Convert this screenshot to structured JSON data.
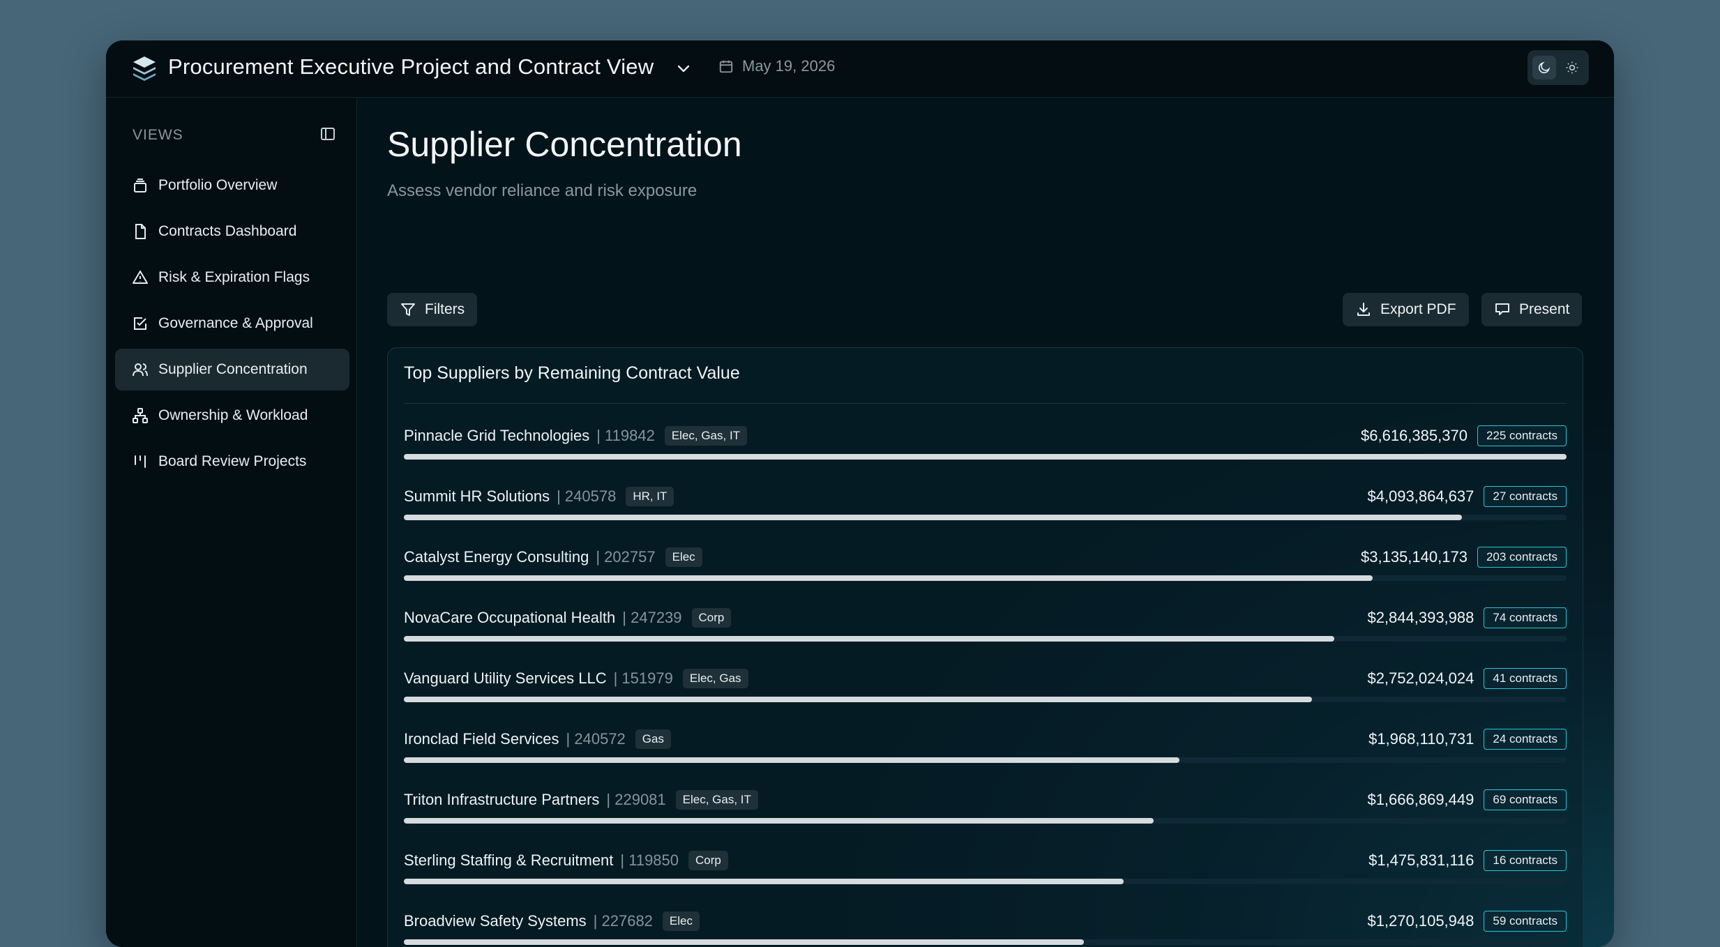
{
  "header": {
    "title": "Procurement Executive Project and Contract View",
    "date": "May 19, 2026"
  },
  "sidebar": {
    "section_label": "VIEWS",
    "items": [
      {
        "label": "Portfolio Overview",
        "icon": "layers-icon"
      },
      {
        "label": "Contracts Dashboard",
        "icon": "file-icon"
      },
      {
        "label": "Risk & Expiration Flags",
        "icon": "warning-icon"
      },
      {
        "label": "Governance & Approval",
        "icon": "checkbox-icon"
      },
      {
        "label": "Supplier Concentration",
        "icon": "users-icon",
        "active": true
      },
      {
        "label": "Ownership & Workload",
        "icon": "org-chart-icon"
      },
      {
        "label": "Board Review Projects",
        "icon": "kanban-icon"
      }
    ]
  },
  "main": {
    "title": "Supplier Concentration",
    "subtitle": "Assess vendor reliance and risk exposure",
    "filters_label": "Filters",
    "export_label": "Export PDF",
    "present_label": "Present"
  },
  "card": {
    "title": "Top Suppliers by Remaining Contract Value",
    "suppliers": [
      {
        "name": "Pinnacle Grid Technologies",
        "id": "| 119842",
        "tags": "Elec, Gas, IT",
        "amount": "$6,616,385,370",
        "contracts": "225 contracts",
        "share": 1.0
      },
      {
        "name": "Summit HR Solutions",
        "id": "| 240578",
        "tags": "HR, IT",
        "amount": "$4,093,864,637",
        "contracts": "27 contracts",
        "share": 0.91
      },
      {
        "name": "Catalyst Energy Consulting",
        "id": "| 202757",
        "tags": "Elec",
        "amount": "$3,135,140,173",
        "contracts": "203 contracts",
        "share": 0.833
      },
      {
        "name": "NovaCare Occupational Health",
        "id": "| 247239",
        "tags": "Corp",
        "amount": "$2,844,393,988",
        "contracts": "74 contracts",
        "share": 0.8
      },
      {
        "name": "Vanguard Utility Services LLC",
        "id": "| 151979",
        "tags": "Elec, Gas",
        "amount": "$2,752,024,024",
        "contracts": "41 contracts",
        "share": 0.781
      },
      {
        "name": "Ironclad Field Services",
        "id": "| 240572",
        "tags": "Gas",
        "amount": "$1,968,110,731",
        "contracts": "24 contracts",
        "share": 0.667
      },
      {
        "name": "Triton Infrastructure Partners",
        "id": "| 229081",
        "tags": "Elec, Gas, IT",
        "amount": "$1,666,869,449",
        "contracts": "69 contracts",
        "share": 0.645
      },
      {
        "name": "Sterling Staffing & Recruitment",
        "id": "| 119850",
        "tags": "Corp",
        "amount": "$1,475,831,116",
        "contracts": "16 contracts",
        "share": 0.619
      },
      {
        "name": "Broadview Safety Systems",
        "id": "| 227682",
        "tags": "Elec",
        "amount": "$1,270,105,948",
        "contracts": "59 contracts",
        "share": 0.585
      }
    ]
  },
  "colors": {
    "accent_border": "#29c6d6",
    "bar_fill": "#d5dbde"
  }
}
